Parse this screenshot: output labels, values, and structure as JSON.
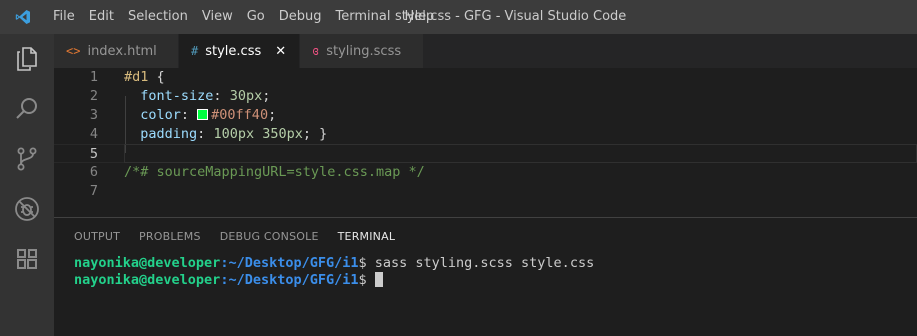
{
  "titlebar": {
    "menu": [
      "File",
      "Edit",
      "Selection",
      "View",
      "Go",
      "Debug",
      "Terminal",
      "Help"
    ],
    "window_title": "style.css - GFG - Visual Studio Code"
  },
  "activitybar": {
    "icons": [
      "explorer-icon",
      "search-icon",
      "source-control-icon",
      "debug-icon",
      "extensions-icon"
    ]
  },
  "tabs": [
    {
      "label": "index.html",
      "icon": "<>",
      "icon_color": "#e37933",
      "active": false
    },
    {
      "label": "style.css",
      "icon": "#",
      "icon_color": "#519aba",
      "active": true,
      "close": "✕"
    },
    {
      "label": "styling.scss",
      "icon": "ɞ",
      "icon_color": "#f55385",
      "active": false
    }
  ],
  "editor": {
    "line_numbers": [
      "1",
      "2",
      "3",
      "4",
      "5",
      "6",
      "7"
    ],
    "current_line": 5,
    "lines": {
      "l1_selector": "#d1",
      "l1_brace": " {",
      "l2_prop": "font-size",
      "l2_value": "30px",
      "l3_prop": "color",
      "l3_value": "#00ff40",
      "l4_prop": "padding",
      "l4_value1": "100px",
      "l4_value2": "350px",
      "l4_end": "; }",
      "l6_comment": "/*# sourceMappingURL=style.css.map */"
    },
    "swatch_color": "#00ff40"
  },
  "panel": {
    "tabs": [
      "OUTPUT",
      "PROBLEMS",
      "DEBUG CONSOLE",
      "TERMINAL"
    ],
    "active_tab": "TERMINAL",
    "terminal": {
      "user": "nayonika@developer",
      "path": ":~/Desktop/GFG/i1",
      "prompt": "$ ",
      "command": "sass styling.scss style.css"
    }
  }
}
